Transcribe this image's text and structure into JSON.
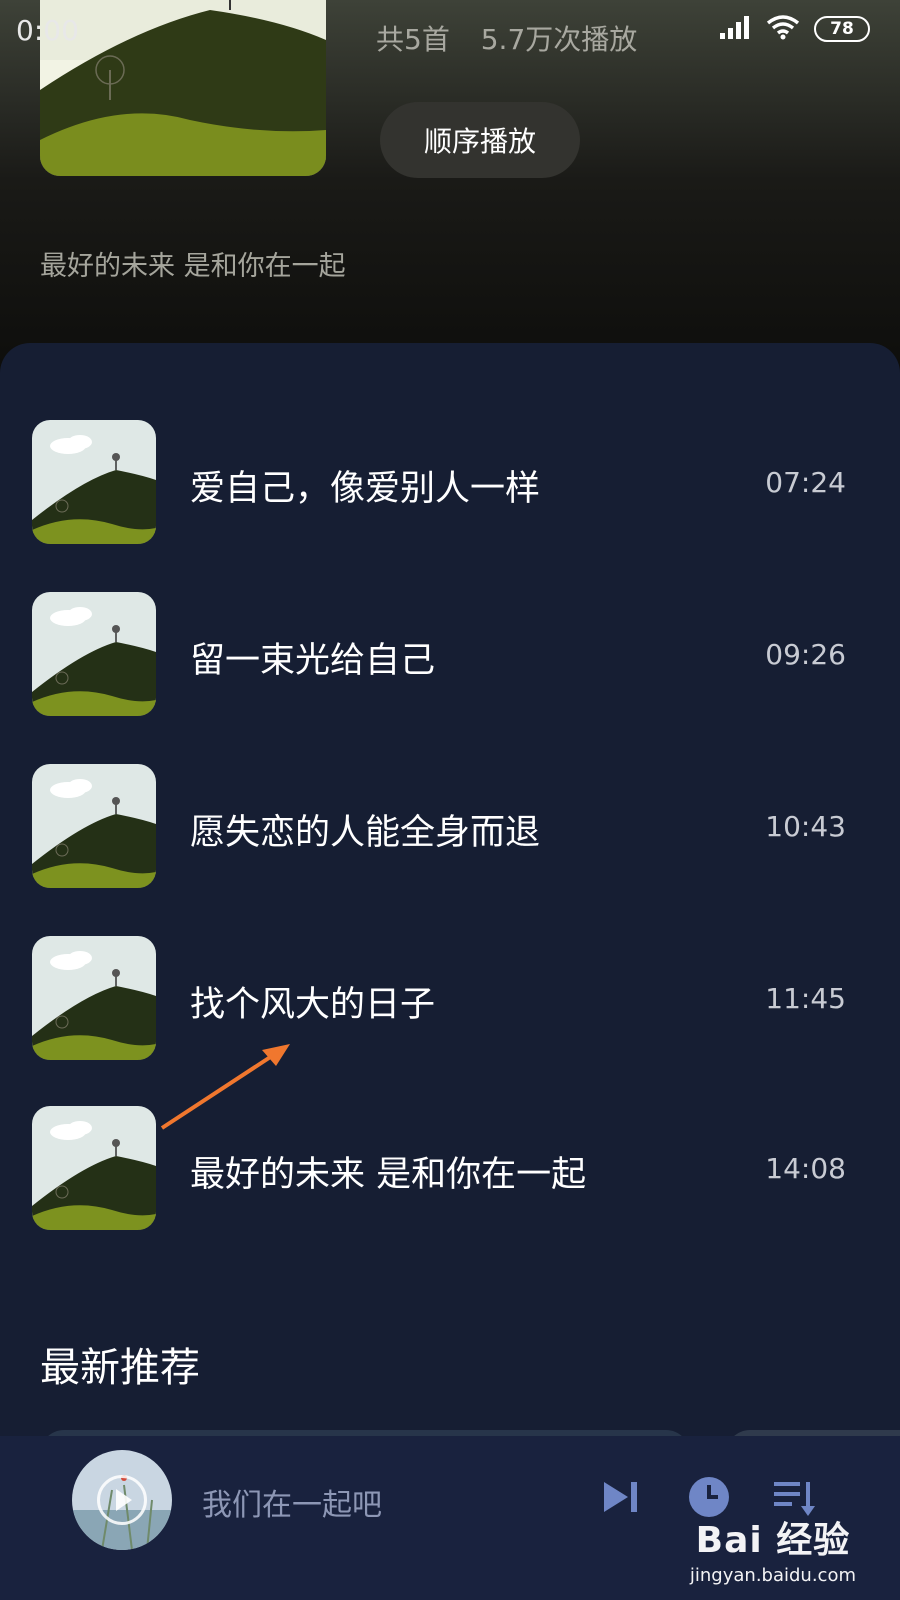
{
  "status_bar": {
    "time": "0:00",
    "battery": "78"
  },
  "album": {
    "stats": {
      "count": "共5首",
      "plays": "5.7万次播放"
    },
    "play_order_label": "顺序播放",
    "description": "最好的未来 是和你在一起"
  },
  "songs": [
    {
      "title": "爱自己，像爱别人一样",
      "duration": "07:24"
    },
    {
      "title": "留一束光给自己",
      "duration": "09:26"
    },
    {
      "title": "愿失恋的人能全身而退",
      "duration": "10:43"
    },
    {
      "title": "找个风大的日子",
      "duration": "11:45"
    },
    {
      "title": "最好的未来 是和你在一起",
      "duration": "14:08"
    }
  ],
  "recommend": {
    "section_title": "最新推荐"
  },
  "player": {
    "song_name": "我们在一起吧"
  },
  "watermark": {
    "logo": "Bai 经验",
    "url": "jingyan.baidu.com"
  },
  "colors": {
    "panel_bg": "#161e33",
    "player_bg": "#19223e",
    "accent_arrow": "#f0772e"
  },
  "icons": [
    "signal-icon",
    "wifi-icon",
    "battery-icon",
    "play-icon",
    "next-track-icon",
    "timer-icon",
    "playlist-icon"
  ]
}
